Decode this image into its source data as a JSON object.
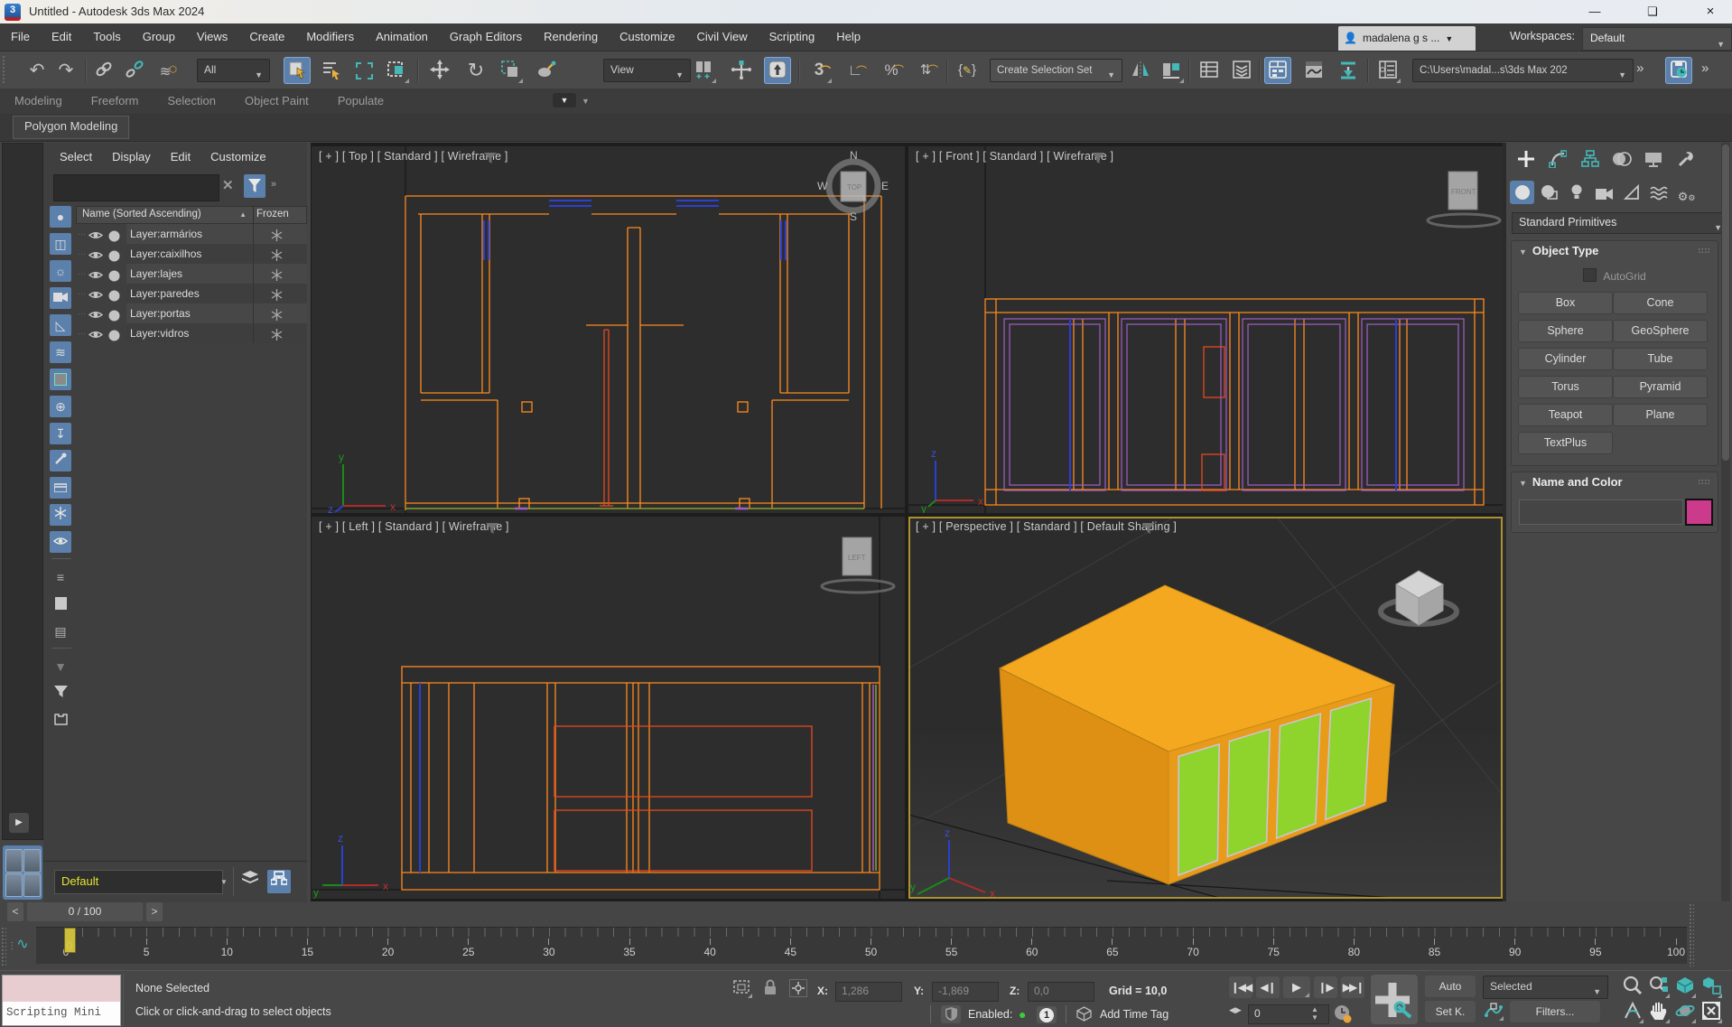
{
  "window": {
    "title": "Untitled - Autodesk 3ds Max 2024",
    "minimize": "—",
    "restore": "❏",
    "close": "×"
  },
  "menubar": {
    "items": [
      "File",
      "Edit",
      "Tools",
      "Group",
      "Views",
      "Create",
      "Modifiers",
      "Animation",
      "Graph Editors",
      "Rendering",
      "Customize",
      "Civil View",
      "Scripting",
      "Help"
    ]
  },
  "account": {
    "user": "madalena g s ...",
    "workspaces_label": "Workspaces:",
    "workspace": "Default"
  },
  "toolbar": {
    "filter": "All",
    "view": "View",
    "selection_set": "Create Selection Set",
    "path": "C:\\Users\\madal...s\\3ds Max 202",
    "overflow": "»",
    "overflow2": "»"
  },
  "ribbon": {
    "tabs": [
      "Modeling",
      "Freeform",
      "Selection",
      "Object Paint",
      "Populate"
    ],
    "panel_button": "Polygon Modeling"
  },
  "explorer": {
    "menu": [
      "Select",
      "Display",
      "Edit",
      "Customize"
    ],
    "name_column": "Name (Sorted Ascending)",
    "sort_arrow": "▲",
    "frozen_column": "Frozen",
    "layers": [
      {
        "name": "Layer:armários"
      },
      {
        "name": "Layer:caixilhos"
      },
      {
        "name": "Layer:lajes"
      },
      {
        "name": "Layer:paredes"
      },
      {
        "name": "Layer:portas"
      },
      {
        "name": "Layer:vidros"
      }
    ],
    "layout_preset": "Default"
  },
  "viewports": {
    "top": {
      "label": "[ + ]  [ Top ]  [ Standard ]  [ Wireframe ]",
      "cube": "TOP"
    },
    "front": {
      "label": "[ + ]  [ Front ]  [ Standard ]  [ Wireframe ]",
      "cube": "FRONT"
    },
    "left": {
      "label": "[ + ]  [ Left ]  [ Standard ]  [ Wireframe ]",
      "cube": "LEFT"
    },
    "perspective": {
      "label": "[ + ]  [ Perspective ]  [ Standard ]  [ Default Shading ]"
    },
    "compass": {
      "n": "N",
      "w": "W",
      "e": "E",
      "s": "S"
    }
  },
  "axes": {
    "x": "x",
    "y": "y",
    "z": "z"
  },
  "command_panel": {
    "category_dropdown": "Standard Primitives",
    "object_type": {
      "title": "Object Type",
      "autogrid": "AutoGrid",
      "buttons": [
        "Box",
        "Cone",
        "Sphere",
        "GeoSphere",
        "Cylinder",
        "Tube",
        "Torus",
        "Pyramid",
        "Teapot",
        "Plane",
        "TextPlus"
      ]
    },
    "name_color": {
      "title": "Name and Color",
      "name_value": "",
      "swatch_color": "#cc3a8c"
    }
  },
  "timeline": {
    "prev": "<",
    "next": ">",
    "frame_range": "0 / 100",
    "current_frame_label": "0",
    "ticks": [
      "0",
      "5",
      "10",
      "15",
      "20",
      "25",
      "30",
      "35",
      "40",
      "45",
      "50",
      "55",
      "60",
      "65",
      "70",
      "75",
      "80",
      "85",
      "90",
      "95",
      "100"
    ]
  },
  "statusbar": {
    "mini_listener": "Scripting Mini",
    "selection": "None Selected",
    "prompt": "Click or click-and-drag to select objects",
    "x_label": "X:",
    "x_value": "1,286",
    "y_label": "Y:",
    "y_value": "-1,869",
    "z_label": "Z:",
    "z_value": "0,0",
    "grid": "Grid = 10,0",
    "enabled_label": "Enabled:",
    "enabled_count": "1",
    "add_time_tag": "Add Time Tag",
    "auto": "Auto",
    "set_key": "Set K.",
    "selected_dropdown": "Selected",
    "filters": "Filters...",
    "frame_spinner": "0"
  },
  "colors": {
    "wire_orange": "#ff8a1e",
    "window_blue": "#2a3fd4",
    "frame_purple": "#a05fc8",
    "door_red": "#e8491e",
    "glass_green": "#8fd42c",
    "accent_blue": "#5b80ab",
    "accent_teal": "#45b8b8",
    "active_viewport_border": "#ad9030",
    "swatch_pink": "#cc3a8c"
  }
}
